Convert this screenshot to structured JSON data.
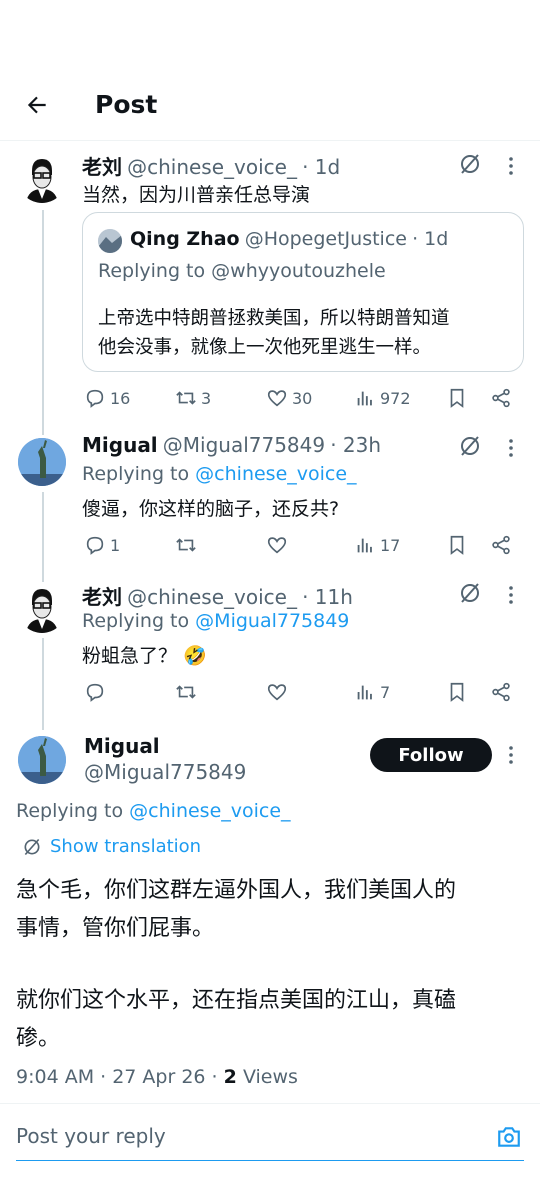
{
  "header": {
    "title": "Post"
  },
  "tweets": [
    {
      "name": "老刘",
      "handle": "@chinese_voice_",
      "time": "· 1d",
      "text": "当然，因为川普亲任总导演",
      "quote": {
        "name": "Qing Zhao",
        "handle": "@HopegetJustice",
        "time": "· 1d",
        "replying_to": "Replying to @whyyoutouzhele",
        "text_line1": "上帝选中特朗普拯救美国，所以特朗普知道",
        "text_line2": "他会没事，就像上一次他死里逃生一样。"
      },
      "actions": {
        "replies": "16",
        "retweets": "3",
        "likes": "30",
        "views": "972"
      }
    },
    {
      "name": "Migual",
      "handle": "@Migual775849",
      "time": "· 23h",
      "replying_label": "Replying to",
      "replying_handle": "@chinese_voice_",
      "text": "傻逼，你这样的脑子，还反共?",
      "actions": {
        "replies": "1",
        "retweets": "",
        "likes": "",
        "views": "17"
      }
    },
    {
      "name": "老刘",
      "handle": "@chinese_voice_",
      "time": "· 11h",
      "replying_label": "Replying to",
      "replying_handle": "@Migual775849",
      "text": "粉蛆急了？ 🤣",
      "actions": {
        "replies": "",
        "retweets": "",
        "likes": "",
        "views": "7"
      }
    }
  ],
  "main_tweet": {
    "name": "Migual",
    "handle": "@Migual775849",
    "follow_label": "Follow",
    "replying_label": "Replying to",
    "replying_handle": "@chinese_voice_",
    "show_translation": "Show translation",
    "para1_line1": "急个毛，你们这群左逼外国人，我们美国人的",
    "para1_line2": "事情，管你们屁事。",
    "para2_line1": "就你们这个水平，还在指点美国的江山，真磕",
    "para2_line2": "碜。",
    "time": "9:04 AM · 27 Apr 26 ·",
    "views_count": "2",
    "views_label": "Views"
  },
  "reply": {
    "placeholder": "Post your reply"
  },
  "colors": {
    "link": "#1d9bf0",
    "text": "#0f1419",
    "secondary": "#536471",
    "follow_bg": "#0f1419"
  },
  "icons": [
    "back-arrow-icon",
    "grok-icon",
    "more-icon",
    "reply-icon",
    "retweet-icon",
    "like-icon",
    "views-icon",
    "bookmark-icon",
    "share-icon",
    "translate-icon",
    "camera-icon"
  ]
}
